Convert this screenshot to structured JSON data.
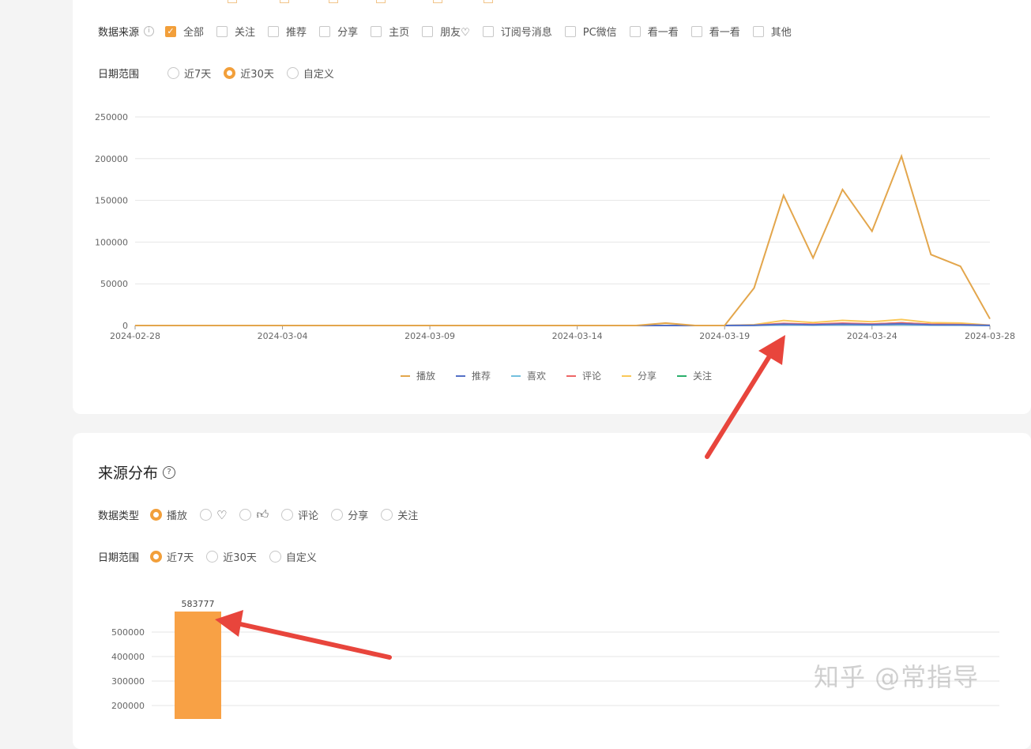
{
  "trend": {
    "source_label": "数据来源",
    "sources": [
      {
        "label": "全部",
        "checked": true
      },
      {
        "label": "关注",
        "checked": false
      },
      {
        "label": "推荐",
        "checked": false
      },
      {
        "label": "分享",
        "checked": false
      },
      {
        "label": "主页",
        "checked": false
      },
      {
        "label": "朋友♡",
        "checked": false
      },
      {
        "label": "订阅号消息",
        "checked": false
      },
      {
        "label": "PC微信",
        "checked": false
      },
      {
        "label": "看一看",
        "checked": false
      },
      {
        "label": "看一看",
        "checked": false
      },
      {
        "label": "其他",
        "checked": false
      }
    ],
    "date_label": "日期范围",
    "date_options": [
      {
        "label": "近7天",
        "checked": false
      },
      {
        "label": "近30天",
        "checked": true
      },
      {
        "label": "自定义",
        "checked": false
      }
    ]
  },
  "chart_data": [
    {
      "type": "line",
      "title": "",
      "xlabel": "",
      "ylabel": "",
      "ylim": [
        0,
        250000
      ],
      "yticks": [
        "0",
        "50000",
        "100000",
        "150000",
        "200000",
        "250000"
      ],
      "xtick_labels": [
        "2024-02-28",
        "2024-03-04",
        "2024-03-09",
        "2024-03-14",
        "2024-03-19",
        "2024-03-24",
        "2024-03-28"
      ],
      "x": [
        "2024-02-28",
        "2024-02-29",
        "2024-03-01",
        "2024-03-02",
        "2024-03-03",
        "2024-03-04",
        "2024-03-05",
        "2024-03-06",
        "2024-03-07",
        "2024-03-08",
        "2024-03-09",
        "2024-03-10",
        "2024-03-11",
        "2024-03-12",
        "2024-03-13",
        "2024-03-14",
        "2024-03-15",
        "2024-03-16",
        "2024-03-17",
        "2024-03-18",
        "2024-03-19",
        "2024-03-20",
        "2024-03-21",
        "2024-03-22",
        "2024-03-23",
        "2024-03-24",
        "2024-03-25",
        "2024-03-26",
        "2024-03-27",
        "2024-03-28"
      ],
      "grid": true,
      "legend_position": "bottom",
      "series": [
        {
          "name": "播放",
          "color": "#e3a64c",
          "values": [
            0,
            0,
            0,
            0,
            0,
            0,
            0,
            0,
            0,
            0,
            0,
            0,
            0,
            0,
            0,
            0,
            0,
            0,
            3000,
            0,
            0,
            45000,
            156000,
            81000,
            163000,
            113000,
            203000,
            85000,
            71000,
            8000
          ]
        },
        {
          "name": "推荐",
          "color": "#5470c6",
          "values": [
            0,
            0,
            0,
            0,
            0,
            0,
            0,
            0,
            0,
            0,
            0,
            0,
            0,
            0,
            0,
            0,
            0,
            0,
            0,
            0,
            0,
            200,
            1500,
            800,
            1600,
            1100,
            2000,
            800,
            700,
            100
          ]
        },
        {
          "name": "喜欢",
          "color": "#73c0de",
          "values": [
            0,
            0,
            0,
            0,
            0,
            0,
            0,
            0,
            0,
            0,
            0,
            0,
            0,
            0,
            0,
            0,
            0,
            0,
            0,
            0,
            0,
            100,
            600,
            400,
            700,
            500,
            900,
            400,
            300,
            50
          ]
        },
        {
          "name": "评论",
          "color": "#ee6666",
          "values": [
            0,
            0,
            0,
            0,
            0,
            0,
            0,
            0,
            0,
            0,
            0,
            0,
            0,
            0,
            0,
            0,
            0,
            0,
            0,
            0,
            0,
            300,
            2500,
            1500,
            2800,
            1800,
            3200,
            1500,
            1200,
            200
          ]
        },
        {
          "name": "分享",
          "color": "#fac858",
          "values": [
            0,
            0,
            0,
            0,
            0,
            0,
            0,
            0,
            0,
            0,
            0,
            0,
            0,
            0,
            0,
            0,
            0,
            0,
            200,
            0,
            0,
            1000,
            6000,
            3500,
            6200,
            4500,
            7200,
            3400,
            3000,
            400
          ]
        },
        {
          "name": "关注",
          "color": "#2aaf6b",
          "values": [
            0,
            0,
            0,
            0,
            0,
            0,
            0,
            0,
            0,
            0,
            0,
            0,
            0,
            0,
            0,
            0,
            0,
            0,
            0,
            0,
            0,
            300,
            1800,
            1200,
            2000,
            1500,
            3200,
            1300,
            1000,
            200
          ]
        }
      ]
    },
    {
      "type": "bar",
      "title": "",
      "xlabel": "",
      "ylabel": "",
      "ylim": [
        0,
        600000
      ],
      "yticks": [
        "200000",
        "300000",
        "400000",
        "500000"
      ],
      "categories": [
        ""
      ],
      "values": [
        583777
      ],
      "data_labels": [
        "583777"
      ],
      "bar_color": "#f8a145",
      "grid": true
    }
  ],
  "distribution": {
    "title": "来源分布",
    "type_label": "数据类型",
    "type_options": [
      {
        "label": "播放",
        "icon": "",
        "checked": true
      },
      {
        "label": "",
        "icon": "heart-icon",
        "checked": false
      },
      {
        "label": "",
        "icon": "thumbs-up-icon",
        "checked": false
      },
      {
        "label": "评论",
        "icon": "",
        "checked": false
      },
      {
        "label": "分享",
        "icon": "",
        "checked": false
      },
      {
        "label": "关注",
        "icon": "",
        "checked": false
      }
    ],
    "date_label": "日期范围",
    "date_options": [
      {
        "label": "近7天",
        "checked": true
      },
      {
        "label": "近30天",
        "checked": false
      },
      {
        "label": "自定义",
        "checked": false
      }
    ]
  },
  "watermark": "知乎 @常指导",
  "colors": {
    "accent": "#f29f3a",
    "annotation_arrow": "#e8453c"
  }
}
